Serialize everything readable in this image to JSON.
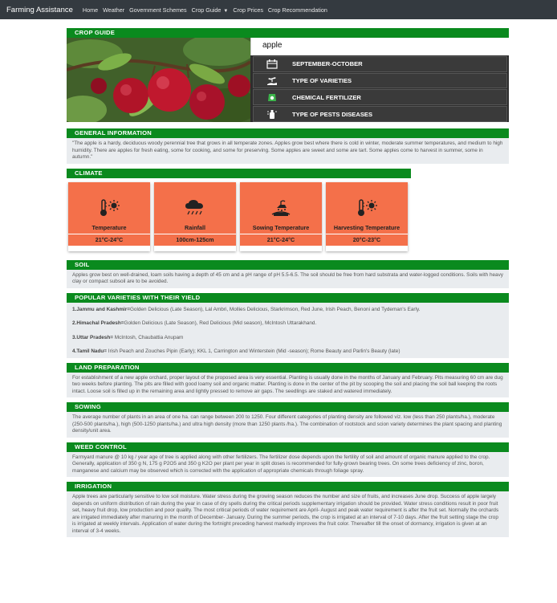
{
  "navbar": {
    "brand": "Farming Assistance",
    "links": [
      "Home",
      "Weather",
      "Government Schemes",
      "Crop Guide",
      "Crop Prices",
      "Crop Recommendation"
    ]
  },
  "colors": {
    "navbar": "#343a40",
    "section_green": "#0a8a1e",
    "card_orange": "#f4704a",
    "panel_dark": "#2d2d2d"
  },
  "crop_guide": {
    "header": "CROP GUIDE",
    "crop_name": "apple",
    "items": [
      {
        "icon": "calendar-icon",
        "label": "SEPTEMBER-OCTOBER"
      },
      {
        "icon": "seedling-hand-icon",
        "label": "TYPE OF VARIETIES"
      },
      {
        "icon": "fertilizer-bag-icon",
        "label": "CHEMICAL FERTILIZER"
      },
      {
        "icon": "pest-spray-icon",
        "label": "TYPE OF PESTS DISEASES"
      }
    ]
  },
  "general": {
    "header": "GENERAL INFORMATION",
    "text": "\"The apple is a hardy, deciduous woody perennial tree that grows in all temperate zones. Apples grow best where there is cold in winter, moderate summer temperatures, and medium to high humidity. There are apples for fresh eating, some for cooking, and some for preserving. Some apples are sweet and some are tart. Some apples come to harvest in summer, some in autumn.\""
  },
  "climate": {
    "header": "CLIMATE",
    "cards": [
      {
        "icon": "thermometer-sun-icon",
        "label": "Temperature",
        "value": "21°C-24°C"
      },
      {
        "icon": "rain-cloud-icon",
        "label": "Rainfall",
        "value": "100cm-125cm"
      },
      {
        "icon": "sowing-icon",
        "label": "Sowing Temperature",
        "value": "21°C-24°C"
      },
      {
        "icon": "thermometer-sun-icon",
        "label": "Harvesting Temperature",
        "value": "20°C-23°C"
      }
    ]
  },
  "soil": {
    "header": "SOIL",
    "text": "Apples grow best on well-drained, loam soils having a depth of 45 cm and a pH range of pH 5.5-6.5. The soil should be free from hard substrata and water-logged conditions. Soils with heavy clay or compact subsoil are to be avoided."
  },
  "varieties": {
    "header": "POPULAR VARIETIES WITH THEIR YIELD",
    "items": [
      {
        "region": "1.Jammu and Kashmir=",
        "text": "Golden Delicious (Late Season), Lal Ambri, Mollies Delicious, Starkrimson, Red June, Irish Peach, Benoni and Tydeman's Early."
      },
      {
        "region": "2.Himachal Pradesh=",
        "text": "Golden Delicious (Late Season), Red Delicious (Mid season), McIntosh Uttarakhand."
      },
      {
        "region": "3.Uttar Pradesh=",
        "text": " McIntosh, Chaubattia Anupam"
      },
      {
        "region": "4.Tamil Nadu=",
        "text": " Irish Peach and Zouches Pipin (Early); KKL 1, Carrington and Winterstein (Mid -season); Rome Beauty and Parlin's Beauty (late)"
      }
    ]
  },
  "land": {
    "header": "LAND PREPARATION",
    "text": "For establishment of a new apple orchard, proper layout of the proposed area is very essential. Planting is usually done in the months of January and February. Pits measuring 60 cm are dug two weeks before planting. The pits are filled with good loamy soil and organic matter. Planting is done in the center of the pit by scooping the soil and placing the soil ball keeping the roots intact. Loose soil is filled up in the remaining area and lightly pressed to remove air gaps. The seedlings are staked and watered immediately."
  },
  "sowing": {
    "header": "SOWING",
    "text": "The average number of plants in an area of one ha. can range between 200 to 1250. Four different categories of planting density are followed viz. low (less than 250 plants/ha.), moderate (250-500 plants/ha.), high (500-1250 plants/ha.) and ultra high density (more than 1250 plants /ha.). The combination of rootstock and scion variety determines the plant spacing and planting density/unit area."
  },
  "weed": {
    "header": "WEED CONTROL",
    "text": "Farmyard manure @ 10 kg / year age of tree is applied along with other fertilizers. The fertilizer dose depends upon the fertility of soil and amount of organic manure applied to the crop. Generally, application of 350 g N, 175 g P2O5 and 350 g K2O per plant per year in split doses is recommended for fully-grown bearing trees. On some trees deficiency of zinc, boron, manganese and calcium may be observed which is corrected with the application of appropriate chemicals through foliage spray."
  },
  "irrigation": {
    "header": "IRRIGATION",
    "text": "Apple trees are particularly sensitive to low soil moisture. Water stress during the growing season reduces the number and size of fruits, and increases June drop. Success of apple largely depends on uniform distribution of rain during the year in case of dry spells during the critical periods supplementary irrigation should be provided. Water stress conditions result in poor fruit set, heavy fruit drop, low production and poor quality. The most critical periods of water requirement are April- August and peak water requirement is after the fruit set. Normally the orchards are irrigated immediately after manuring in the month of December- January. During the summer periods, the crop is irrigated at an interval of 7-10 days. After the fruit setting stage the crop is irrigated at weekly intervals. Application of water during the fortnight preceding harvest markedly improves the fruit color. Thereafter till the onset of dormancy, irrigation is given at an interval of 3-4 weeks."
  }
}
